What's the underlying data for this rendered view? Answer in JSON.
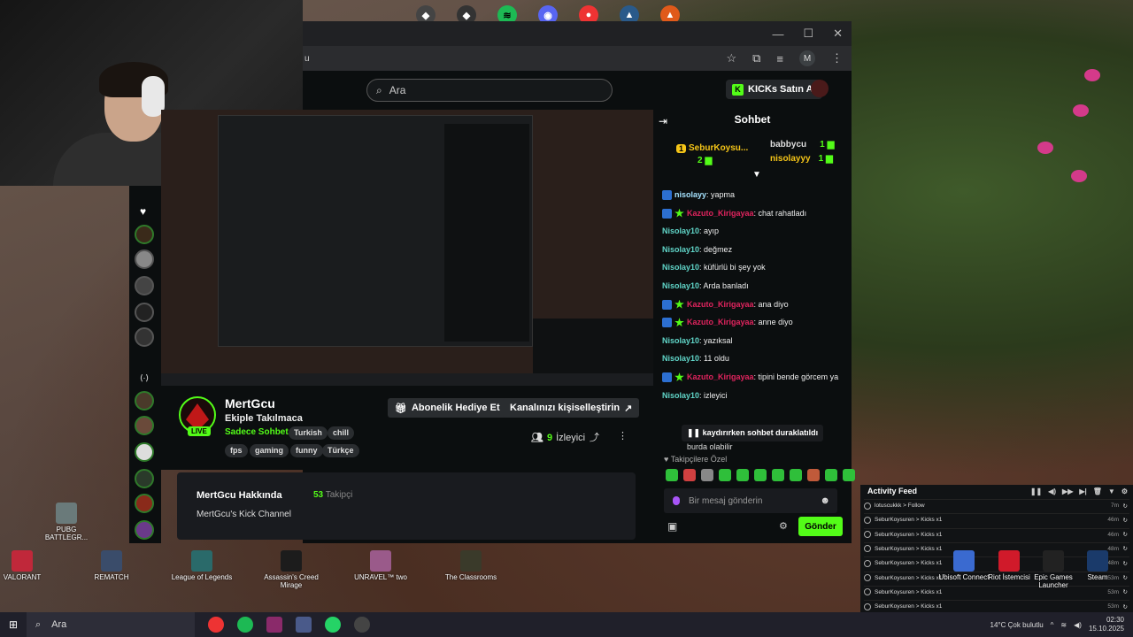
{
  "browser": {
    "url_fragment": "u",
    "search_placeholder": "Ara",
    "buy_kicks": "KICKs Satın Al",
    "profile_initial": "M"
  },
  "stream": {
    "streamer": "MertGcu",
    "title": "Ekiple Takılmaca",
    "category": "Sadece Sohbet",
    "live": "LIVE",
    "tags": [
      "Turkish",
      "chill",
      "fps",
      "gaming",
      "funny",
      "Türkçe"
    ],
    "gift_sub": "Abonelik Hediye Et",
    "customize": "Kanalınızı kişiselleştirin",
    "viewers_count": "9",
    "viewers_label": "İzleyici"
  },
  "about": {
    "title": "MertGcu Hakkında",
    "followers_count": "53",
    "followers_label": "Takipçi",
    "description": "MertGcu's Kick Channel"
  },
  "chat": {
    "header": "Sohbet",
    "pinned": [
      {
        "name": "SeburKoysu...",
        "count": "2",
        "rank": "1"
      },
      {
        "name": "babbycu",
        "count": "1"
      },
      {
        "name": "nisolayyy",
        "count": "1"
      }
    ],
    "messages": [
      {
        "badges": [
          "kick"
        ],
        "user": "nisolayy",
        "color": "#a6e3ff",
        "text": "yapma"
      },
      {
        "badges": [
          "kick",
          "star"
        ],
        "user": "Kazuto_Kirigayaa",
        "color": "#e0245e",
        "text": "chat rahatladı"
      },
      {
        "badges": [],
        "user": "Nisolay10",
        "color": "#60d5c8",
        "text": "ayıp"
      },
      {
        "badges": [],
        "user": "Nisolay10",
        "color": "#60d5c8",
        "text": "değmez"
      },
      {
        "badges": [],
        "user": "Nisolay10",
        "color": "#60d5c8",
        "text": "küfürlü bi şey yok"
      },
      {
        "badges": [],
        "user": "Nisolay10",
        "color": "#60d5c8",
        "text": "Arda banladı"
      },
      {
        "badges": [
          "kick",
          "star"
        ],
        "user": "Kazuto_Kirigayaa",
        "color": "#e0245e",
        "text": "ana diyo"
      },
      {
        "badges": [
          "kick",
          "star"
        ],
        "user": "Kazuto_Kirigayaa",
        "color": "#e0245e",
        "text": "anne diyo"
      },
      {
        "badges": [],
        "user": "Nisolay10",
        "color": "#60d5c8",
        "text": "yazıksal"
      },
      {
        "badges": [],
        "user": "Nisolay10",
        "color": "#60d5c8",
        "text": "11 oldu"
      },
      {
        "badges": [
          "kick",
          "star"
        ],
        "user": "Kazuto_Kirigayaa",
        "color": "#e0245e",
        "text": "tipini bende görcem ya"
      },
      {
        "badges": [],
        "user": "Nisolay10",
        "color": "#60d5c8",
        "text": "izleyici"
      }
    ],
    "paused": "kaydırırken sohbet duraklatıldı",
    "partial_message": "burda olabilir",
    "followers_only": "Takipçilere Özel",
    "input_placeholder": "Bir mesaj gönderin",
    "send": "Gönder"
  },
  "activity": {
    "title": "Activity Feed",
    "rows": [
      {
        "text": "lotuscukkk > Follow",
        "time": "7m"
      },
      {
        "text": "SeburKoysuren > Kicks x1",
        "time": "46m"
      },
      {
        "text": "SeburKoysuren > Kicks x1",
        "time": "46m"
      },
      {
        "text": "SeburKoysuren > Kicks x1",
        "time": "48m"
      },
      {
        "text": "SeburKoysuren > Kicks x1",
        "time": "48m"
      },
      {
        "text": "SeburKoysuren > Kicks x1",
        "time": "53m"
      },
      {
        "text": "SeburKoysuren > Kicks x1",
        "time": "53m"
      },
      {
        "text": "SeburKoysuren > Kicks x1",
        "time": "53m"
      },
      {
        "text": "SeburKoysuren > Kicks x1",
        "time": "53m"
      },
      {
        "text": "SeburKoysuren > Kicks x1",
        "time": "53m"
      }
    ]
  },
  "desktop_icons": [
    {
      "label": "PUBG BATTLEGR...",
      "color": "#6a7a7a"
    },
    {
      "label": "VALORANT",
      "color": "#c0283a"
    },
    {
      "label": "REMATCH",
      "color": "#3a4c6a"
    },
    {
      "label": "League of Legends",
      "color": "#2a6a6a"
    },
    {
      "label": "Assassin's Creed Mirage",
      "color": "#1c1c1c"
    },
    {
      "label": "UNRAVEL™ two",
      "color": "#9a5a8a"
    },
    {
      "label": "The Classrooms",
      "color": "#3a3a2a"
    },
    {
      "label": "Ubisoft Connect",
      "color": "#3a6ad0"
    },
    {
      "label": "Riot İstemcisi",
      "color": "#d01a2a"
    },
    {
      "label": "Epic Games Launcher",
      "color": "#222222"
    },
    {
      "label": "Steam",
      "color": "#1a3a6a"
    }
  ],
  "taskbar": {
    "search": "Ara",
    "weather": "14°C Çok bulutlu",
    "time": "02:30",
    "date": "15.10.2025"
  }
}
